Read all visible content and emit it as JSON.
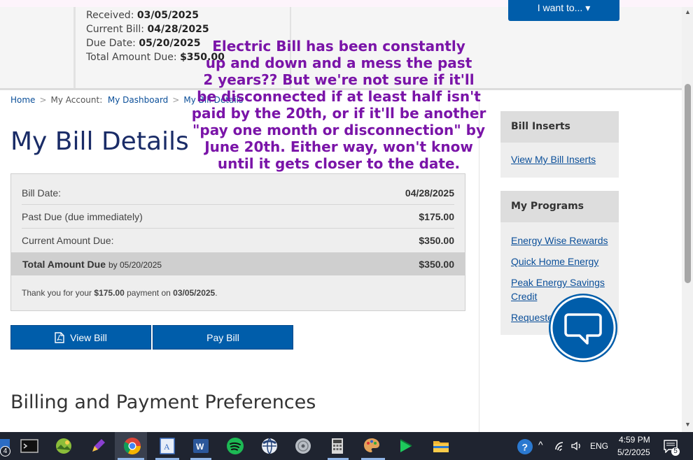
{
  "account_summary": {
    "received_label": "Received:",
    "received_value": "03/05/2025",
    "current_bill_label": "Current Bill:",
    "current_bill_value": "04/28/2025",
    "due_date_label": "Due Date:",
    "due_date_value": "05/20/2025",
    "total_due_label": "Total Amount Due:",
    "total_due_value": "$350.00"
  },
  "header": {
    "i_want_to_label": "I want to... ▾"
  },
  "breadcrumb": {
    "home": "Home",
    "my_account": "My Account:",
    "dashboard": "My Dashboard",
    "bill_details": "My Bill Details"
  },
  "page_title": "My Bill Details",
  "bill_table": {
    "rows": [
      {
        "label": "Bill Date:",
        "value": "04/28/2025"
      },
      {
        "label": "Past Due (due immediately)",
        "value": "$175.00"
      },
      {
        "label": "Current Amount Due:",
        "value": "$350.00"
      }
    ],
    "total": {
      "label": "Total Amount Due",
      "by": "by 05/20/2025",
      "value": "$350.00"
    },
    "thanks": {
      "pre": "Thank you for your ",
      "amount": "$175.00",
      "mid": " payment on ",
      "date": "03/05/2025",
      "post": "."
    }
  },
  "buttons": {
    "view_bill": "View Bill",
    "pay_bill": "Pay Bill"
  },
  "section_heading": "Billing and Payment Preferences",
  "sidebar": {
    "bill_inserts": {
      "heading": "Bill Inserts",
      "links": [
        "View My Bill Inserts"
      ]
    },
    "my_programs": {
      "heading": "My Programs",
      "links": [
        "Energy Wise Rewards",
        "Quick Home Energy",
        "Peak Energy Savings Credit",
        "Requested"
      ]
    }
  },
  "overlay_note": "Electric Bill has been constantly\nup and down and a mess the past\n2 years??  But we're not sure if it'll\nbe disconnected if at least half isn't\npaid by the 20th, or if it'll be another\n\"pay one month or disconnection\" by\nJune 20th.  Either way, won't know\nuntil it gets closer to the date.",
  "taskbar": {
    "left_badge": "4",
    "language": "ENG",
    "time": "4:59 PM",
    "date": "5/2/2025",
    "notification_count": "5",
    "apps": [
      "terminal-icon",
      "landscape-app-icon",
      "pen-tool-icon",
      "chrome-icon",
      "notepad-app-icon",
      "word-icon",
      "spotify-icon",
      "browser-globe-icon",
      "disc-app-icon",
      "calculator-icon",
      "paint-palette-icon",
      "media-player-icon",
      "file-explorer-icon"
    ]
  },
  "colors": {
    "brand_blue": "#005daa",
    "title_navy": "#1a2c67",
    "note_purple": "#7a14a8",
    "link_blue": "#0b4f99"
  }
}
